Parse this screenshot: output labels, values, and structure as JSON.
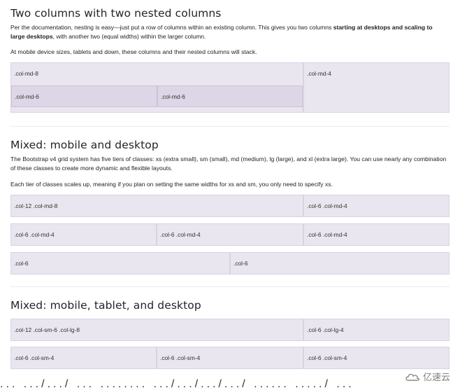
{
  "section1": {
    "title": "Two columns with two nested columns",
    "p1_a": "Per the documentation, nesting is easy—just put a row of columns within an existing column. This gives you two columns ",
    "p1_b": "starting at desktops and scaling to large desktops",
    "p1_c": ", with another two (equal widths) within the larger column.",
    "p2": "At mobile device sizes, tablets and down, these columns and their nested columns will stack.",
    "outer_left": ".col-md-8",
    "outer_right": ".col-md-4",
    "nested": [
      ".col-md-6",
      ".col-md-6"
    ]
  },
  "section2": {
    "title": "Mixed: mobile and desktop",
    "p1": "The Bootstrap v4 grid system has five tiers of classes: xs (extra small), sm (small), md (medium), lg (large), and xl (extra large). You can use nearly any combination of these classes to create more dynamic and flexible layouts.",
    "p2": "Each tier of classes scales up, meaning if you plan on setting the same widths for xs and sm, you only need to specify xs.",
    "row1": [
      ".col-12 .col-md-8",
      ".col-6 .col-md-4"
    ],
    "row2": [
      ".col-6 .col-md-4",
      ".col-6 .col-md-4",
      ".col-6 .col-md-4"
    ],
    "row3": [
      ".col-6",
      ".col-6"
    ]
  },
  "section3": {
    "title": "Mixed: mobile, tablet, and desktop",
    "row1": [
      ".col-12 .col-sm-6 .col-lg-8",
      ".col-6 .col-lg-4"
    ],
    "row2": [
      ".col-6 .col-sm-4",
      ".col-6 .col-sm-4",
      ".col-6 .col-sm-4"
    ]
  },
  "footer": {
    "partial_text": "... .../.../ ... ........ .../.../.../.../ ...... ...../ ...",
    "watermark": "亿速云"
  },
  "colors": {
    "cell_bg": "#e9e6f0",
    "cell_border": "#d8d3e3",
    "nested_bg": "#dcd6e7"
  }
}
